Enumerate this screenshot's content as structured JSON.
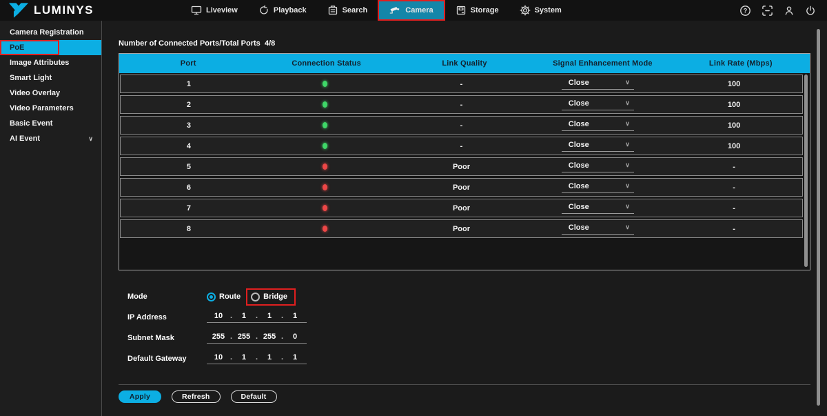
{
  "brand": {
    "name": "LUMINYS"
  },
  "colors": {
    "accent_cyan": "#0CAEE3",
    "active_tab_teal": "#1486A9",
    "highlight_red": "#E01F1F",
    "status_green": "#3FD868",
    "status_red": "#EE4747"
  },
  "topbar": {
    "nav": [
      {
        "label": "Liveview",
        "icon": "liveview-monitor-icon",
        "active": false
      },
      {
        "label": "Playback",
        "icon": "playback-icon",
        "active": false
      },
      {
        "label": "Search",
        "icon": "search-doc-icon",
        "active": false
      },
      {
        "label": "Camera",
        "icon": "camera-icon",
        "active": true
      },
      {
        "label": "Storage",
        "icon": "storage-icon",
        "active": false
      },
      {
        "label": "System",
        "icon": "system-gear-icon",
        "active": false
      }
    ],
    "right_icons": [
      "help-icon",
      "scan-icon",
      "user-icon",
      "power-icon"
    ]
  },
  "sidebar": {
    "items": [
      {
        "label": "Camera Registration",
        "active": false,
        "highlighted": false,
        "expandable": false
      },
      {
        "label": "PoE",
        "active": true,
        "highlighted": true,
        "expandable": false
      },
      {
        "label": "Image Attributes",
        "active": false,
        "highlighted": false,
        "expandable": false
      },
      {
        "label": "Smart Light",
        "active": false,
        "highlighted": false,
        "expandable": false
      },
      {
        "label": "Video Overlay",
        "active": false,
        "highlighted": false,
        "expandable": false
      },
      {
        "label": "Video Parameters",
        "active": false,
        "highlighted": false,
        "expandable": false
      },
      {
        "label": "Basic Event",
        "active": false,
        "highlighted": false,
        "expandable": false
      },
      {
        "label": "AI Event",
        "active": false,
        "highlighted": false,
        "expandable": true
      }
    ]
  },
  "main": {
    "summary": {
      "label": "Number of Connected Ports/Total Ports",
      "value": "4/8"
    },
    "table": {
      "headers": [
        "Port",
        "Connection Status",
        "Link Quality",
        "Signal Enhancement Mode",
        "Link Rate (Mbps)"
      ],
      "rows": [
        {
          "port": "1",
          "status": "connected",
          "quality": "-",
          "mode": "Close",
          "rate": "100"
        },
        {
          "port": "2",
          "status": "connected",
          "quality": "-",
          "mode": "Close",
          "rate": "100"
        },
        {
          "port": "3",
          "status": "connected",
          "quality": "-",
          "mode": "Close",
          "rate": "100"
        },
        {
          "port": "4",
          "status": "connected",
          "quality": "-",
          "mode": "Close",
          "rate": "100"
        },
        {
          "port": "5",
          "status": "disconnected",
          "quality": "Poor",
          "mode": "Close",
          "rate": "-"
        },
        {
          "port": "6",
          "status": "disconnected",
          "quality": "Poor",
          "mode": "Close",
          "rate": "-"
        },
        {
          "port": "7",
          "status": "disconnected",
          "quality": "Poor",
          "mode": "Close",
          "rate": "-"
        },
        {
          "port": "8",
          "status": "disconnected",
          "quality": "Poor",
          "mode": "Close",
          "rate": "-"
        }
      ]
    },
    "form": {
      "mode": {
        "label": "Mode",
        "options": [
          {
            "label": "Route",
            "selected": true,
            "highlighted": false
          },
          {
            "label": "Bridge",
            "selected": false,
            "highlighted": true
          }
        ]
      },
      "fields": [
        {
          "label": "IP Address",
          "octets": [
            "10",
            "1",
            "1",
            "1"
          ]
        },
        {
          "label": "Subnet Mask",
          "octets": [
            "255",
            "255",
            "255",
            "0"
          ]
        },
        {
          "label": "Default Gateway",
          "octets": [
            "10",
            "1",
            "1",
            "1"
          ]
        }
      ]
    },
    "actions": [
      {
        "label": "Apply",
        "primary": true
      },
      {
        "label": "Refresh",
        "primary": false
      },
      {
        "label": "Default",
        "primary": false
      }
    ]
  }
}
